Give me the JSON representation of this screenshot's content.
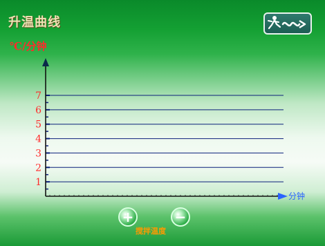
{
  "header": {
    "title": "升温曲线",
    "y_unit": "℃/分钟",
    "back_icon": "running-man-arrow-icon"
  },
  "chart_data": {
    "type": "line",
    "xlabel": "分钟",
    "ylabel": "℃/分钟",
    "ylim": [
      0,
      7
    ],
    "yticks": [
      "1",
      "2",
      "3",
      "4",
      "5",
      "6",
      "7"
    ],
    "grid": true,
    "series": []
  },
  "controls": {
    "plus_icon": "plus-circle-icon",
    "minus_icon": "minus-circle-icon",
    "stir_label": "搅拌温度"
  },
  "colors": {
    "accent": "#ff2b2b",
    "axis": "#2a63ff",
    "grid": "#0a1f7a"
  }
}
